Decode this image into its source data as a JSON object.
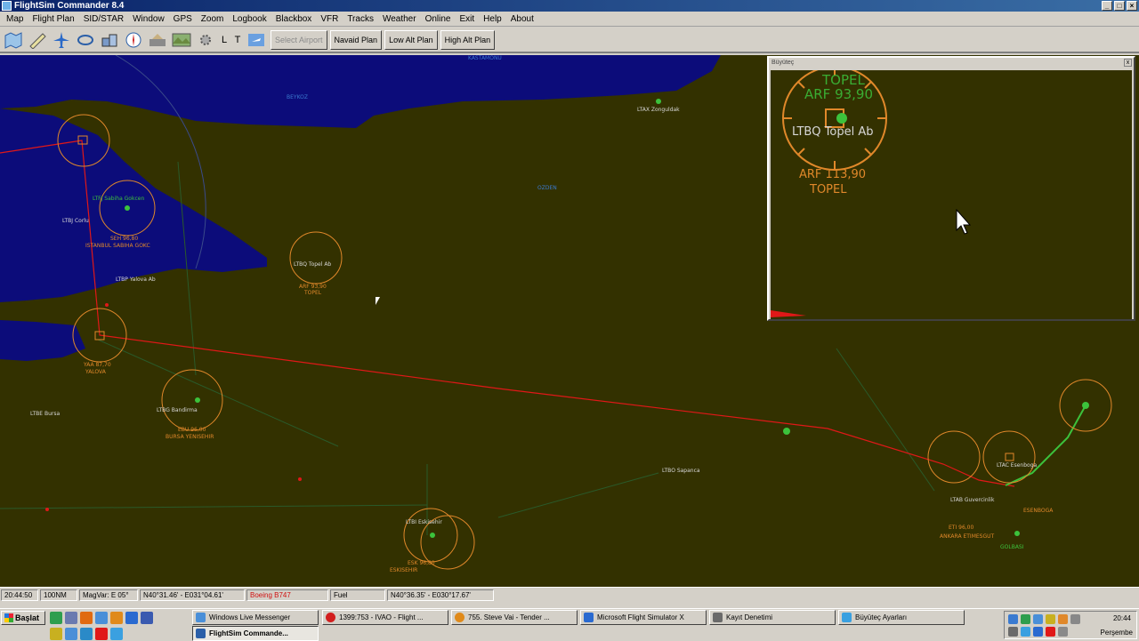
{
  "window": {
    "title": "FlightSim Commander 8.4"
  },
  "menu": [
    "Map",
    "Flight Plan",
    "SID/STAR",
    "Window",
    "GPS",
    "Zoom",
    "Logbook",
    "Blackbox",
    "VFR",
    "Tracks",
    "Weather",
    "Online",
    "Exit",
    "Help",
    "About"
  ],
  "toolbar": {
    "letters": [
      "L",
      "T"
    ],
    "select_airport": "Select Airport",
    "navaid_plan": "Navaid Plan",
    "low_alt_plan": "Low Alt Plan",
    "high_alt_plan": "High Alt Plan"
  },
  "map": {
    "labels": [
      {
        "text": "LTBQ Topel Ab",
        "color": "white"
      },
      {
        "text": "ARF 93,90",
        "color": "orange"
      },
      {
        "text": "TOPEL",
        "color": "orange"
      },
      {
        "text": "LTBP Yalova Ab",
        "color": "white"
      },
      {
        "text": "YAA 87,70",
        "color": "orange"
      },
      {
        "text": "YALOVA",
        "color": "orange"
      },
      {
        "text": "LTBE Bursa",
        "color": "white"
      },
      {
        "text": "LTFJ Sabiha Gokcen",
        "color": "green"
      },
      {
        "text": "SEH 96,80",
        "color": "orange"
      },
      {
        "text": "ISTANBUL SABIHA GOKC",
        "color": "orange"
      },
      {
        "text": "LTBJ Corlu",
        "color": "white"
      },
      {
        "text": "LTBG Bandirma",
        "color": "white"
      },
      {
        "text": "EBU 96,00",
        "color": "orange"
      },
      {
        "text": "BURSA YENISEHIR",
        "color": "orange"
      },
      {
        "text": "LTAX Zonguldak",
        "color": "white"
      },
      {
        "text": "LTAB Guvercinlik",
        "color": "white"
      },
      {
        "text": "LTAC Esenboga",
        "color": "white"
      },
      {
        "text": "ETI 96,00",
        "color": "orange"
      },
      {
        "text": "ANKARA ETIMESGUT",
        "color": "orange"
      },
      {
        "text": "ESK 96,80",
        "color": "orange"
      },
      {
        "text": "ESKISEHIR",
        "color": "orange"
      },
      {
        "text": "LTBI Eskisehir",
        "color": "white"
      },
      {
        "text": "LTBO Sapanca",
        "color": "white"
      },
      {
        "text": "BEYKOZ",
        "color": "blue"
      },
      {
        "text": "OZDEN",
        "color": "blue"
      },
      {
        "text": "KASTAMONU",
        "color": "blue"
      },
      {
        "text": "ESENBOGA",
        "color": "orange"
      },
      {
        "text": "GOLBASI",
        "color": "green"
      }
    ]
  },
  "magnifier": {
    "title": "Büyüteç",
    "close": "x",
    "airport_label": "LTBQ Topel Ab",
    "vor_freq": "ARF 113,90",
    "vor_name": "TOPEL",
    "ghost_name": "TOPEL",
    "ghost_freq": "ARF 93,90"
  },
  "status": {
    "time": "20:44:50",
    "range": "100NM",
    "magvar": "MagVar: E 05°",
    "position": "N40°31.46' - E031°04.61'",
    "aircraft": "Boeing B747",
    "fuel": "Fuel",
    "position2": "N40°36.35' - E030°17.67'"
  },
  "taskbar": {
    "start": "Başlat",
    "tasks": [
      {
        "label": "Windows Live Messenger",
        "color": "#4a8fd8"
      },
      {
        "label": "1399:753 - IVAO - Flight ...",
        "color": "#d21e1e"
      },
      {
        "label": "755. Steve Vai - Tender ...",
        "color": "#e08a1a"
      },
      {
        "label": "Microsoft Flight Simulator X",
        "color": "#2a6ad0"
      },
      {
        "label": "Kayıt Denetimi",
        "color": "#6a6a6a"
      },
      {
        "label": "Büyüteç Ayarları",
        "color": "#3aa0e0"
      },
      {
        "label": "FlightSim Commande...",
        "color": "#2b5fa8"
      }
    ],
    "clock": "20:44",
    "day": "Perşembe"
  }
}
